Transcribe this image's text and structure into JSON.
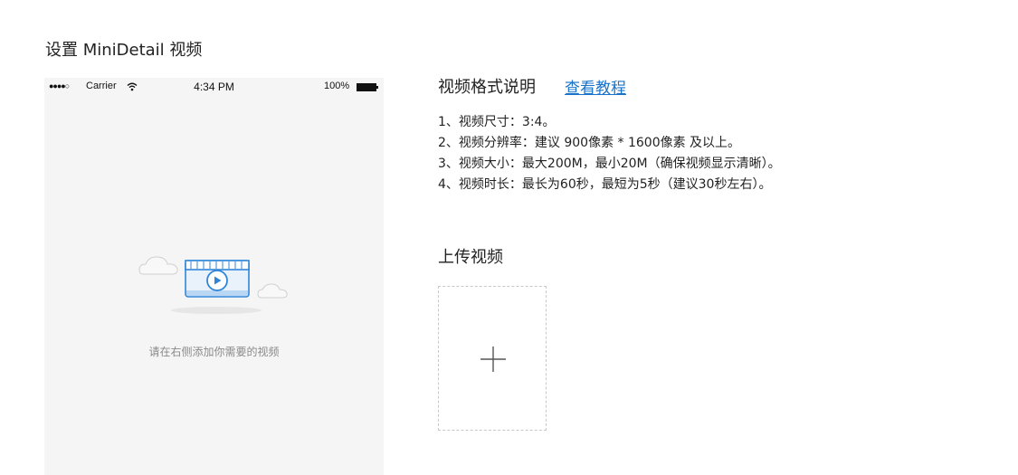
{
  "page": {
    "title": "设置 MiniDetail 视频"
  },
  "phone_preview": {
    "status_bar": {
      "signal": "●●●●○",
      "carrier": "Carrier",
      "time": "4:34 PM",
      "battery": "100%"
    },
    "empty_hint": "请在右侧添加你需要的视频"
  },
  "format_info": {
    "heading": "视频格式说明",
    "tutorial_link": "查看教程",
    "items": [
      "1、视频尺寸：3:4。",
      "2、视频分辨率：建议 900像素 * 1600像素 及以上。",
      "3、视频大小：最大200M，最小20M（确保视频显示清晰）。",
      "4、视频时长：最长为60秒，最短为5秒（建议30秒左右）。"
    ]
  },
  "upload": {
    "heading": "上传视频"
  },
  "colors": {
    "link": "#1a73c9",
    "illustration_blue": "#2f86d9",
    "preview_bg": "#f5f5f5"
  }
}
